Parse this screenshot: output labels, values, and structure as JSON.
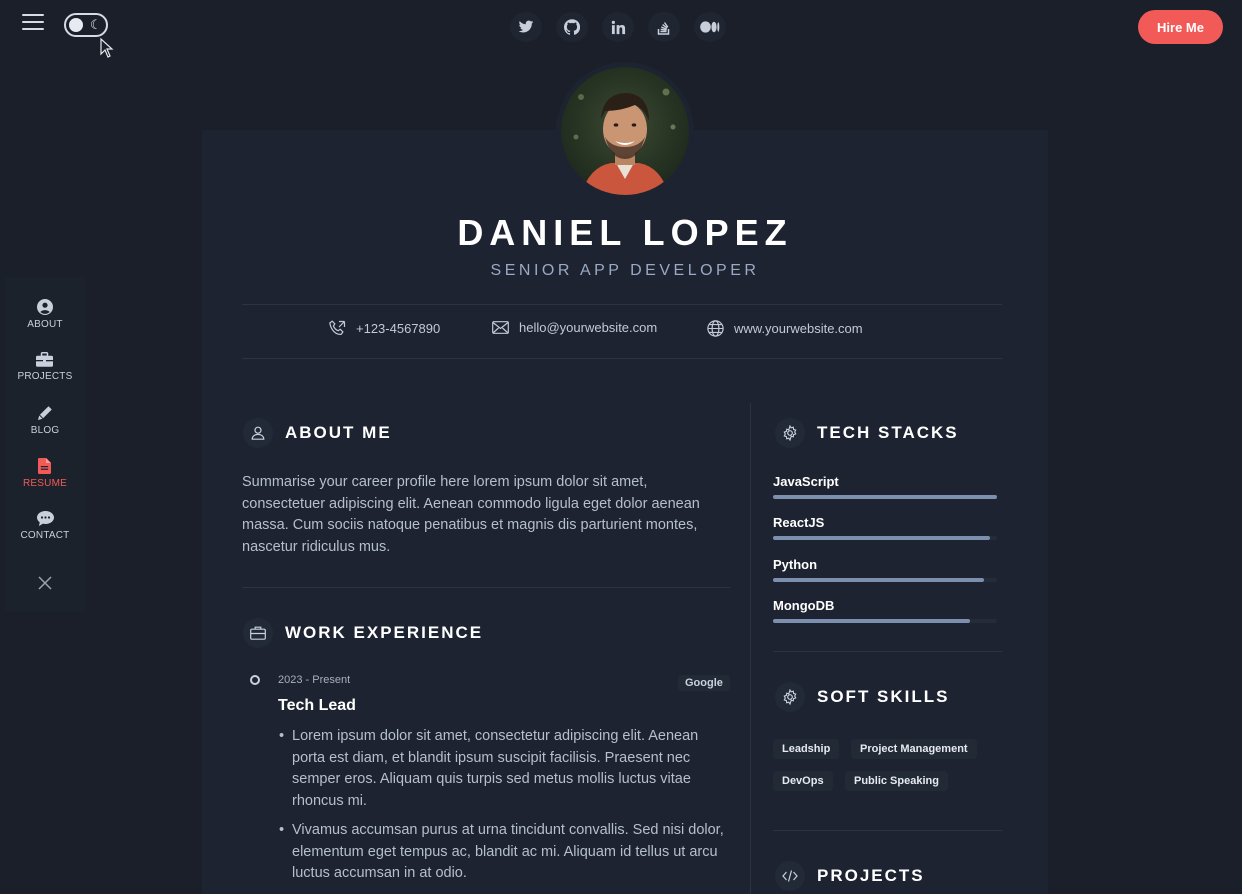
{
  "header": {
    "hire_label": "Hire Me",
    "socials": [
      "twitter-icon",
      "github-icon",
      "linkedin-icon",
      "stackoverflow-icon",
      "medium-icon"
    ]
  },
  "sidenav": {
    "items": [
      {
        "label": "ABOUT",
        "icon": "user-circle-icon"
      },
      {
        "label": "PROJECTS",
        "icon": "briefcase-icon"
      },
      {
        "label": "BLOG",
        "icon": "pen-icon"
      },
      {
        "label": "RESUME",
        "icon": "file-icon"
      },
      {
        "label": "CONTACT",
        "icon": "chat-icon"
      }
    ],
    "active": "RESUME"
  },
  "profile": {
    "name": "DANIEL LOPEZ",
    "role": "SENIOR APP DEVELOPER"
  },
  "contacts": {
    "phone": "+123-4567890",
    "email": "hello@yourwebsite.com",
    "website": "www.yourwebsite.com"
  },
  "about": {
    "title": "ABOUT ME",
    "text": "Summarise your career profile here lorem ipsum dolor sit amet, consectetuer adipiscing elit. Aenean commodo ligula eget dolor aenean massa. Cum sociis natoque penatibus et magnis dis parturient montes, nascetur ridiculus mus."
  },
  "work": {
    "title": "WORK EXPERIENCE",
    "jobs": [
      {
        "date": "2023 - Present",
        "company": "Google",
        "title": "Tech Lead",
        "bullets": [
          "Lorem ipsum dolor sit amet, consectetur adipiscing elit. Aenean porta est diam, et blandit ipsum suscipit facilisis. Praesent nec semper eros. Aliquam quis turpis sed metus mollis luctus vitae rhoncus mi.",
          "Vivamus accumsan purus at urna tincidunt convallis. Sed nisi dolor, elementum eget tempus ac, blandit ac mi. Aliquam id tellus ut arcu luctus accumsan in at odio."
        ]
      }
    ]
  },
  "tech": {
    "title": "TECH STACKS",
    "skills": [
      {
        "name": "JavaScript",
        "level": 1.0
      },
      {
        "name": "ReactJS",
        "level": 0.97
      },
      {
        "name": "Python",
        "level": 0.94
      },
      {
        "name": "MongoDB",
        "level": 0.88
      }
    ]
  },
  "soft": {
    "title": "SOFT SKILLS",
    "tags": [
      "Leadship",
      "Project Management",
      "DevOps",
      "Public Speaking"
    ]
  },
  "projects": {
    "title": "PROJECTS"
  },
  "colors": {
    "accent": "#f25a57",
    "background": "#1a1f29",
    "card": "#1d2330",
    "skill_fill": "#7d8fae"
  }
}
